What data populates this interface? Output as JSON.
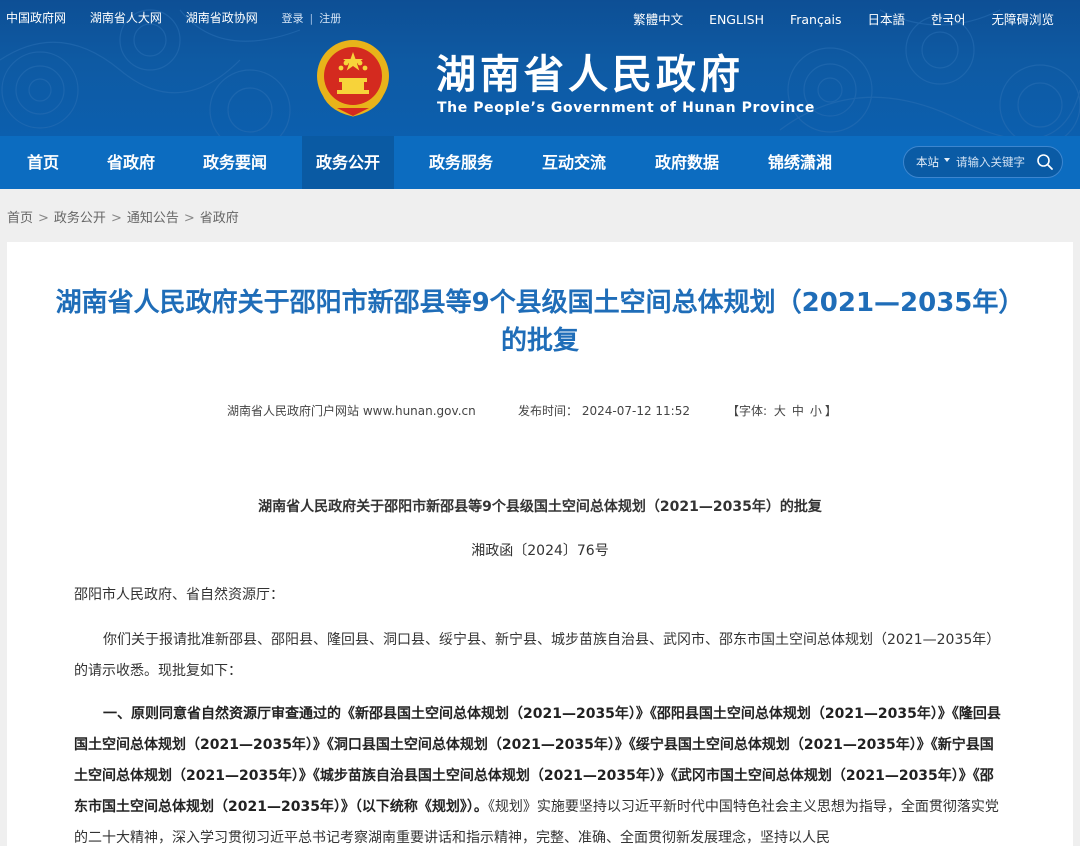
{
  "header": {
    "top_links": [
      "中国政府网",
      "湖南省人大网",
      "湖南省政协网"
    ],
    "login": "登录",
    "register": "注册",
    "auth_separator": "|",
    "languages": [
      "繁體中文",
      "ENGLISH",
      "Français",
      "日本語",
      "한국어",
      "无障碍浏览"
    ],
    "site_title": "湖南省人民政府",
    "site_subtitle": "The People’s Government of Hunan Province"
  },
  "nav": {
    "items": [
      "首页",
      "省政府",
      "政务要闻",
      "政务公开",
      "政务服务",
      "互动交流",
      "政府数据",
      "锦绣潇湘"
    ],
    "active_index": 3,
    "search_scope": "本站",
    "search_placeholder": "请输入关键字"
  },
  "breadcrumb": {
    "items": [
      "首页",
      "政务公开",
      "通知公告",
      "省政府"
    ],
    "separator": ">"
  },
  "article": {
    "title": "湖南省人民政府关于邵阳市新邵县等9个县级国土空间总体规划（2021—2035年）的批复",
    "source": "湖南省人民政府门户网站 www.hunan.gov.cn",
    "publish_label": "发布时间：",
    "publish_time": "2024-07-12 11:52",
    "font_label": "【字体:",
    "font_sizes": [
      "大",
      "中",
      "小"
    ],
    "font_close": "】",
    "doc_heading": "湖南省人民政府关于邵阳市新邵县等9个县级国土空间总体规划（2021—2035年）的批复",
    "doc_number": "湘政函〔2024〕76号",
    "salutation": "邵阳市人民政府、省自然资源厅：",
    "paragraph1": "你们关于报请批准新邵县、邵阳县、隆回县、洞口县、绥宁县、新宁县、城步苗族自治县、武冈市、邵东市国土空间总体规划（2021—2035年）的请示收悉。现批复如下：",
    "paragraph2_bold": "一、原则同意省自然资源厅审查通过的《新邵县国土空间总体规划（2021—2035年）》《邵阳县国土空间总体规划（2021—2035年）》《隆回县国土空间总体规划（2021—2035年）》《洞口县国土空间总体规划（2021—2035年）》《绥宁县国土空间总体规划（2021—2035年）》《新宁县国土空间总体规划（2021—2035年）》《城步苗族自治县国土空间总体规划（2021—2035年）》《武冈市国土空间总体规划（2021—2035年）》《邵东市国土空间总体规划（2021—2035年）》（以下统称《规划》）。",
    "paragraph2_rest": "《规划》实施要坚持以习近平新时代中国特色社会主义思想为指导，全面贯彻落实党的二十大精神，深入学习贯彻习近平总书记考察湖南重要讲话和指示精神，完整、准确、全面贯彻新发展理念，坚持以人民"
  },
  "colors": {
    "banner": "#0e5aa3",
    "nav": "#0c6cc0",
    "nav_active": "#0a5aa3",
    "title_blue": "#1f6db8",
    "page_bg": "#efefef"
  }
}
